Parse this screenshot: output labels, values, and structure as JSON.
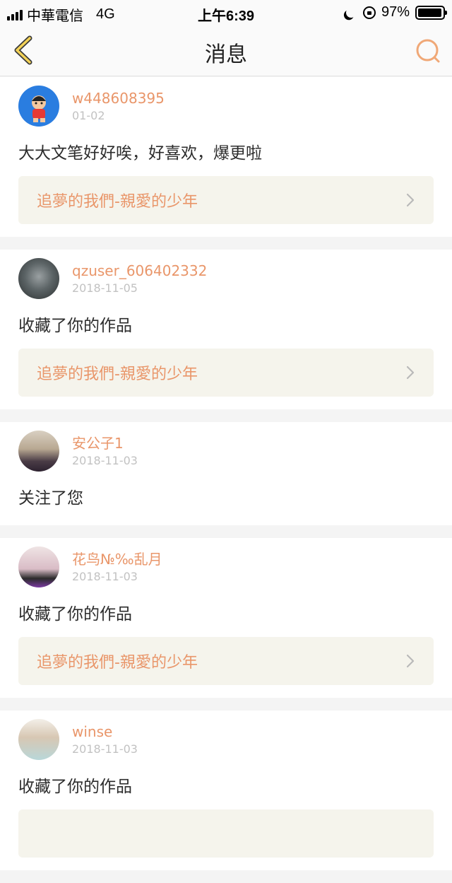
{
  "status_bar": {
    "carrier": "中華電信",
    "network": "4G",
    "time": "上午6:39",
    "battery": "97%",
    "battery_level": 0.97
  },
  "nav": {
    "title": "消息",
    "back_icon": "chevron-left-icon",
    "search_icon": "search-icon",
    "accent_color": "#e9966a"
  },
  "messages": [
    {
      "username": "w448608395",
      "date": "01-02",
      "text": "大大文笔好好唉，好喜欢，爆更啦",
      "work_title": "追夢的我們-親愛的少年"
    },
    {
      "username": "qzuser_606402332",
      "date": "2018-11-05",
      "text": "收藏了你的作品",
      "work_title": "追夢的我們-親愛的少年"
    },
    {
      "username": "安公子1",
      "date": "2018-11-03",
      "text": "关注了您"
    },
    {
      "username": "花鸟№‰乱月",
      "date": "2018-11-03",
      "text": "收藏了你的作品",
      "work_title": "追夢的我們-親愛的少年"
    },
    {
      "username": "winse",
      "date": "2018-11-03",
      "text": "收藏了你的作品"
    }
  ]
}
